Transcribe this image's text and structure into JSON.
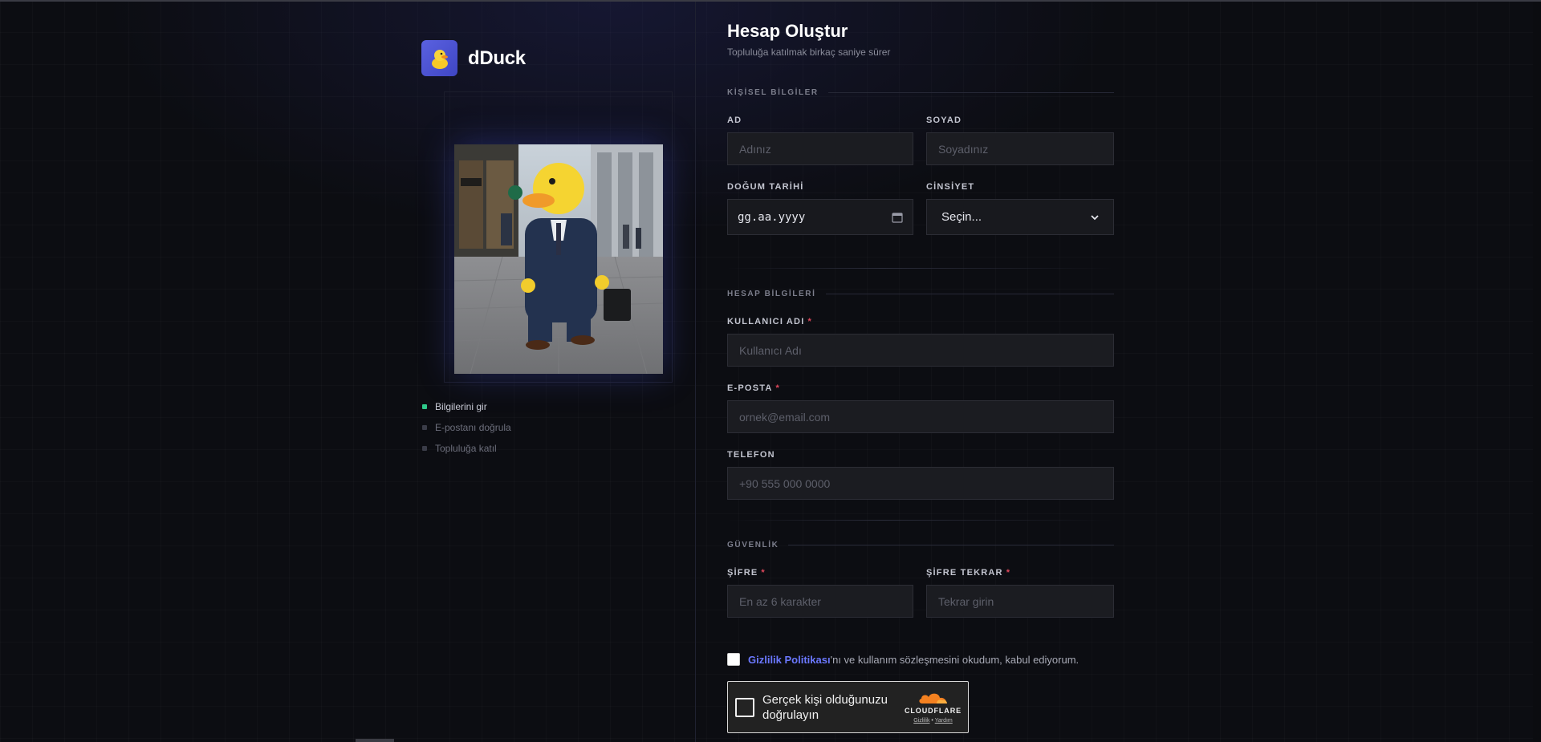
{
  "brand": {
    "name": "dDuck",
    "accent": "#4f56d8"
  },
  "steps": [
    {
      "label": "Bilgilerini gir",
      "active": true
    },
    {
      "label": "E-postanı doğrula",
      "active": false
    },
    {
      "label": "Topluluğa katıl",
      "active": false
    }
  ],
  "form": {
    "title": "Hesap Oluştur",
    "subtitle": "Topluluğa katılmak birkaç saniye sürer",
    "sections": {
      "personal": "KİŞİSEL BİLGİLER",
      "account": "HESAP BİLGİLERİ",
      "security": "GÜVENLİK"
    },
    "fields": {
      "first_name": {
        "label": "AD",
        "placeholder": "Adınız"
      },
      "last_name": {
        "label": "SOYAD",
        "placeholder": "Soyadınız"
      },
      "birth_date": {
        "label": "DOĞUM TARİHİ",
        "placeholder": "gg.aa.yyyy"
      },
      "gender": {
        "label": "CİNSİYET",
        "selected": "Seçin..."
      },
      "username": {
        "label": "KULLANICI ADI",
        "required": "*",
        "placeholder": "Kullanıcı Adı"
      },
      "email": {
        "label": "E-POSTA",
        "required": "*",
        "placeholder": "ornek@email.com"
      },
      "phone": {
        "label": "TELEFON",
        "placeholder": "+90 555 000 0000"
      },
      "password": {
        "label": "ŞİFRE",
        "required": "*",
        "placeholder": "En az 6 karakter"
      },
      "password_repeat": {
        "label": "ŞİFRE TEKRAR",
        "required": "*",
        "placeholder": "Tekrar girin"
      }
    },
    "agreement": {
      "link": "Gizlilik Politikası",
      "text": "'nı ve kullanım sözleşmesini okudum, kabul ediyorum."
    },
    "captcha": {
      "text": "Gerçek kişi olduğunuzu doğrulayın",
      "brand": "CLOUDFLARE",
      "privacy": "Gizlilik",
      "dot": "•",
      "help": "Yardım"
    }
  },
  "icons": {
    "logo": "duck-icon",
    "calendar": "calendar-icon",
    "select": "chevron-down-icon",
    "captcha_brand": "cloud-icon"
  }
}
